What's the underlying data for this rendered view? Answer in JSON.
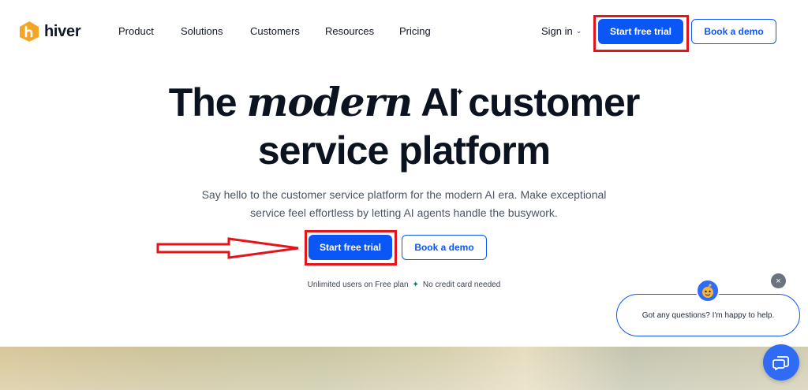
{
  "nav": {
    "brand": "hiver",
    "links": [
      "Product",
      "Solutions",
      "Customers",
      "Resources",
      "Pricing"
    ],
    "sign_in": "Sign in",
    "start_trial": "Start free trial",
    "book_demo": "Book a demo"
  },
  "hero": {
    "headline_part1": "The",
    "headline_italic": "modern",
    "headline_part2": "AI",
    "headline_part3": "customer",
    "headline_line2": "service platform",
    "subtext_line1": "Say hello to the customer service platform for the modern AI era. Make exceptional",
    "subtext_line2": "service feel effortless by letting AI agents handle the busywork.",
    "start_trial": "Start free trial",
    "book_demo": "Book a demo",
    "tagline_left": "Unlimited users on Free plan",
    "tagline_right": "No credit card needed"
  },
  "chat": {
    "message": "Got any questions? I'm happy to help.",
    "close_symbol": "×"
  },
  "colors": {
    "brand_blue": "#0b57f5",
    "highlight_red": "#e3141c",
    "logo_orange": "#f5a524"
  },
  "icons": [
    "hiver-logo-icon",
    "chevron-down-icon",
    "sparkle-icon",
    "star-icon",
    "close-icon",
    "bot-avatar-icon",
    "chat-icon",
    "arrow-annotation"
  ]
}
